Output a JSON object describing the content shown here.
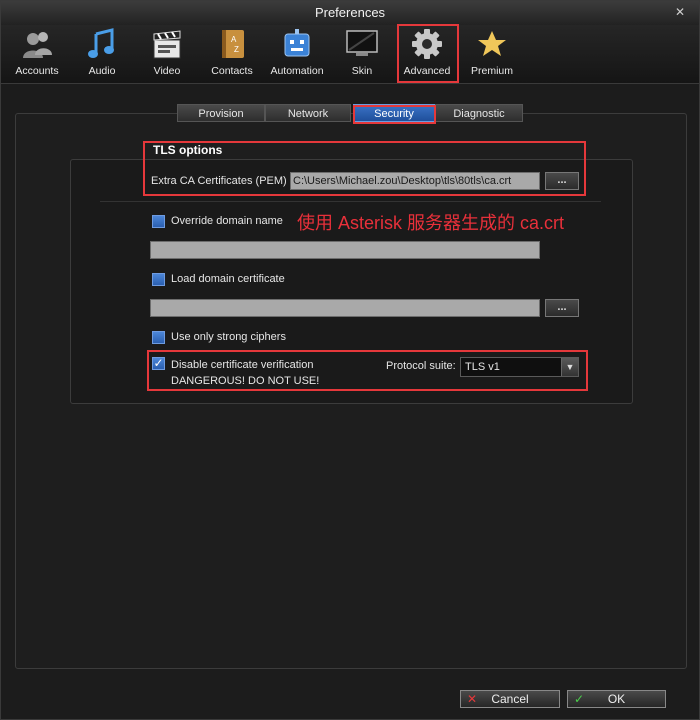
{
  "window": {
    "title": "Preferences",
    "close_glyph": "✕"
  },
  "toolbar": [
    {
      "label": "Accounts",
      "icon": "people-icon"
    },
    {
      "label": "Audio",
      "icon": "music-note-icon"
    },
    {
      "label": "Video",
      "icon": "clapperboard-icon"
    },
    {
      "label": "Contacts",
      "icon": "address-book-icon"
    },
    {
      "label": "Automation",
      "icon": "robot-icon"
    },
    {
      "label": "Skin",
      "icon": "monitor-icon"
    },
    {
      "label": "Advanced",
      "icon": "gear-icon",
      "selected": true
    },
    {
      "label": "Premium",
      "icon": "star-icon"
    }
  ],
  "tabs": [
    {
      "label": "Provision"
    },
    {
      "label": "Network"
    },
    {
      "label": "Security",
      "active": true
    },
    {
      "label": "Diagnostic"
    }
  ],
  "tls": {
    "heading": "TLS options",
    "ca_label": "Extra CA Certificates (PEM)",
    "ca_value": "C:\\Users\\Michael.zou\\Desktop\\tls\\80tls\\ca.crt",
    "browse": "...",
    "override_label": "Override domain name",
    "override_value": "",
    "annotation": "使用 Asterisk 服务器生成的 ca.crt",
    "load_cert_label": "Load domain certificate",
    "load_cert_value": "",
    "strong_ciphers_label": "Use only strong ciphers",
    "disable_verif_label": "Disable certificate verification",
    "danger_label": "DANGEROUS! DO NOT USE!",
    "protocol_label": "Protocol suite:",
    "protocol_value": "TLS v1",
    "check_glyph": "✓"
  },
  "buttons": {
    "cancel": "Cancel",
    "ok": "OK",
    "cancel_glyph": "✕",
    "ok_glyph": "✓"
  },
  "colors": {
    "accent_blue": "#2a5fb0",
    "highlight_red": "#e5383b",
    "annotation_red": "#e8303a"
  }
}
